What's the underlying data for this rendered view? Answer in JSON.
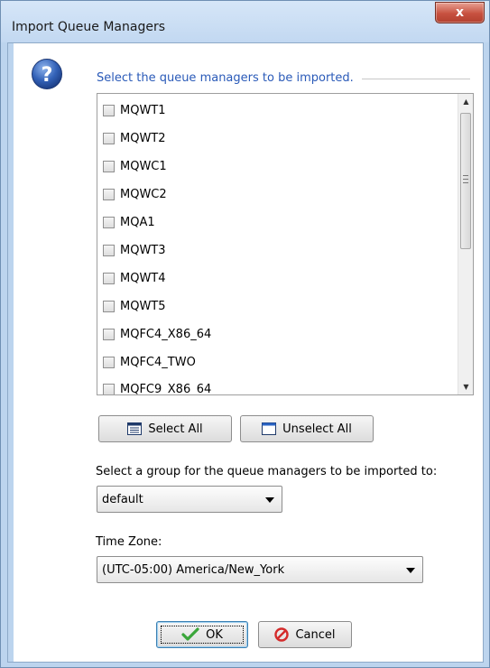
{
  "window": {
    "title": "Import Queue Managers",
    "close_glyph": "x"
  },
  "dialog": {
    "help_icon": "question-icon",
    "heading": "Select the queue managers to be imported.",
    "heading_color": "#2a5ab8",
    "queue_managers": [
      {
        "label": "MQWT1",
        "checked": false
      },
      {
        "label": "MQWT2",
        "checked": false
      },
      {
        "label": "MQWC1",
        "checked": false
      },
      {
        "label": "MQWC2",
        "checked": false
      },
      {
        "label": "MQA1",
        "checked": false
      },
      {
        "label": "MQWT3",
        "checked": false
      },
      {
        "label": "MQWT4",
        "checked": false
      },
      {
        "label": "MQWT5",
        "checked": false
      },
      {
        "label": "MQFC4_X86_64",
        "checked": false
      },
      {
        "label": "MQFC4_TWO",
        "checked": false
      },
      {
        "label": "MQFC9_X86_64",
        "checked": false
      }
    ],
    "select_all_label": "Select All",
    "unselect_all_label": "Unselect All",
    "group_label": "Select a group for the queue managers to be imported to:",
    "group_value": "default",
    "timezone_label": "Time Zone:",
    "timezone_value": "(UTC-05:00) America/New_York",
    "ok_label": "OK",
    "cancel_label": "Cancel"
  }
}
